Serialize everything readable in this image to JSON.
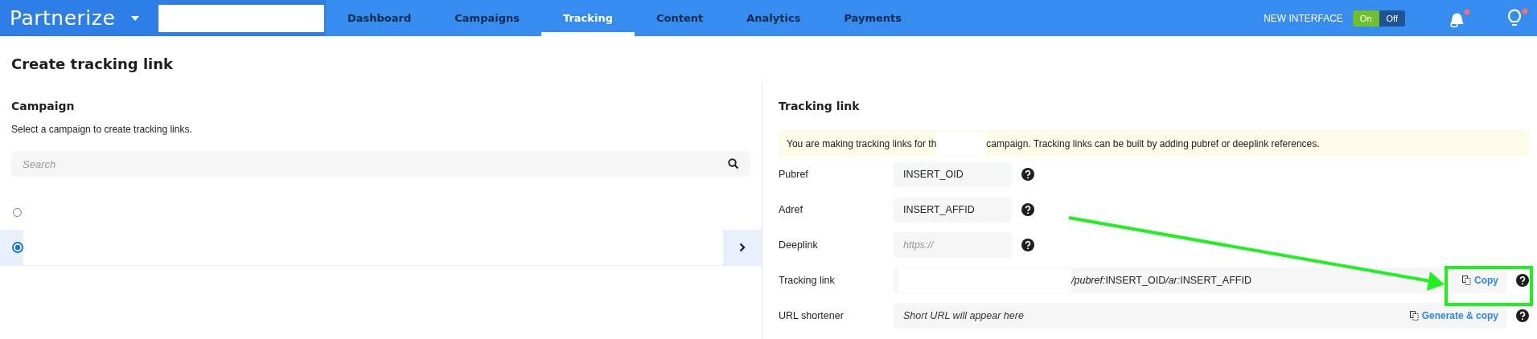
{
  "nav": {
    "logo": "Partnerize",
    "tabs": [
      {
        "label": "Dashboard",
        "selected": false
      },
      {
        "label": "Campaigns",
        "selected": false
      },
      {
        "label": "Tracking",
        "selected": true
      },
      {
        "label": "Content",
        "selected": false
      },
      {
        "label": "Analytics",
        "selected": false
      },
      {
        "label": "Payments",
        "selected": false
      }
    ],
    "interface_label": "NEW INTERFACE",
    "toggle": {
      "on_label": "On",
      "off_label": "Off",
      "on": true
    },
    "notifications_unread": true,
    "tips_unread": true
  },
  "page_title": "Create tracking link",
  "campaign": {
    "heading": "Campaign",
    "description": "Select a campaign to create tracking links.",
    "search": {
      "placeholder": "Search"
    },
    "items": [
      {
        "selected": false
      },
      {
        "selected": true
      }
    ]
  },
  "tracking": {
    "heading": "Tracking link",
    "notice_before": "You are making tracking links for th",
    "notice_after": "campaign. Tracking links can be built by adding pubref or deeplink references.",
    "rows": [
      {
        "kind": "input",
        "label": "Pubref",
        "value": "INSERT_OID"
      },
      {
        "kind": "input",
        "label": "Adref",
        "value": "INSERT_AFFID"
      },
      {
        "kind": "input",
        "label": "Deeplink",
        "placeholder": "https://"
      },
      {
        "kind": "link",
        "label": "Tracking link",
        "segments": [
          {
            "text": "/pubref:",
            "italic": true
          },
          {
            "text": "INSERT_OID",
            "italic": false
          },
          {
            "text": "/ar:",
            "italic": true
          },
          {
            "text": "INSERT_AFFID",
            "italic": false
          }
        ],
        "action": "Copy"
      },
      {
        "kind": "shortener",
        "label": "URL shortener",
        "placeholder": "Short URL will appear here",
        "action": "Generate & copy"
      }
    ]
  }
}
